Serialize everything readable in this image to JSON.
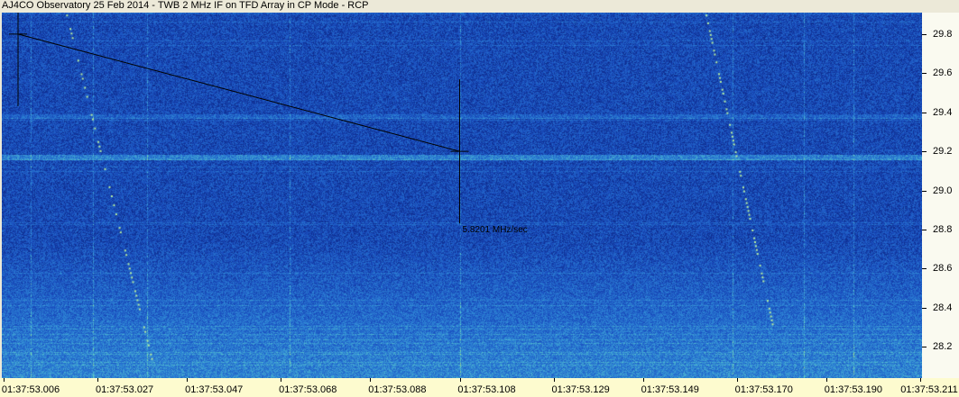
{
  "window": {
    "title": "AJ4CO Observatory 25 Feb 2014 - TWB 2 MHz IF on TFD Array in CP Mode - RCP"
  },
  "chart_data": {
    "type": "heatmap",
    "title": "AJ4CO Observatory 25 Feb 2014 - TWB 2 MHz IF on TFD Array in CP Mode - RCP",
    "xlabel": "",
    "ylabel": "",
    "x_tick_labels": [
      "01:37:53.006",
      "01:37:53.027",
      "01:37:53.047",
      "01:37:53.068",
      "01:37:53.088",
      "01:37:53.108",
      "01:37:53.129",
      "01:37:53.149",
      "01:37:53.170",
      "01:37:53.190",
      "01:37:53.211"
    ],
    "y_tick_values": [
      29.8,
      29.6,
      29.4,
      29.2,
      29.0,
      28.8,
      28.6,
      28.4,
      28.2
    ],
    "y_tick_labels": [
      "29.8",
      "29.6",
      "29.4",
      "29.2",
      "29.0",
      "28.8",
      "28.6",
      "28.4",
      "28.2"
    ],
    "ylim": [
      28.04,
      29.91
    ],
    "xlim": [
      "01:37:53.006",
      "01:37:53.211"
    ],
    "colormap": [
      "#0a1f7a",
      "#1a4fc0",
      "#2e86d6",
      "#5fd0c8",
      "#c8e86a"
    ],
    "measurement": {
      "start": {
        "t": "01:37:53.006",
        "freq": 29.8
      },
      "end": {
        "t": "01:37:53.108",
        "freq": 29.2
      },
      "label": "5.8201 MHz/sec"
    },
    "bursts": [
      {
        "t_start": "01:37:53.020",
        "t_end": "01:37:53.040",
        "f_start": 29.9,
        "f_end": 28.05
      },
      {
        "t_start": "01:37:53.163",
        "t_end": "01:37:53.178",
        "f_start": 29.9,
        "f_end": 28.3
      }
    ]
  }
}
